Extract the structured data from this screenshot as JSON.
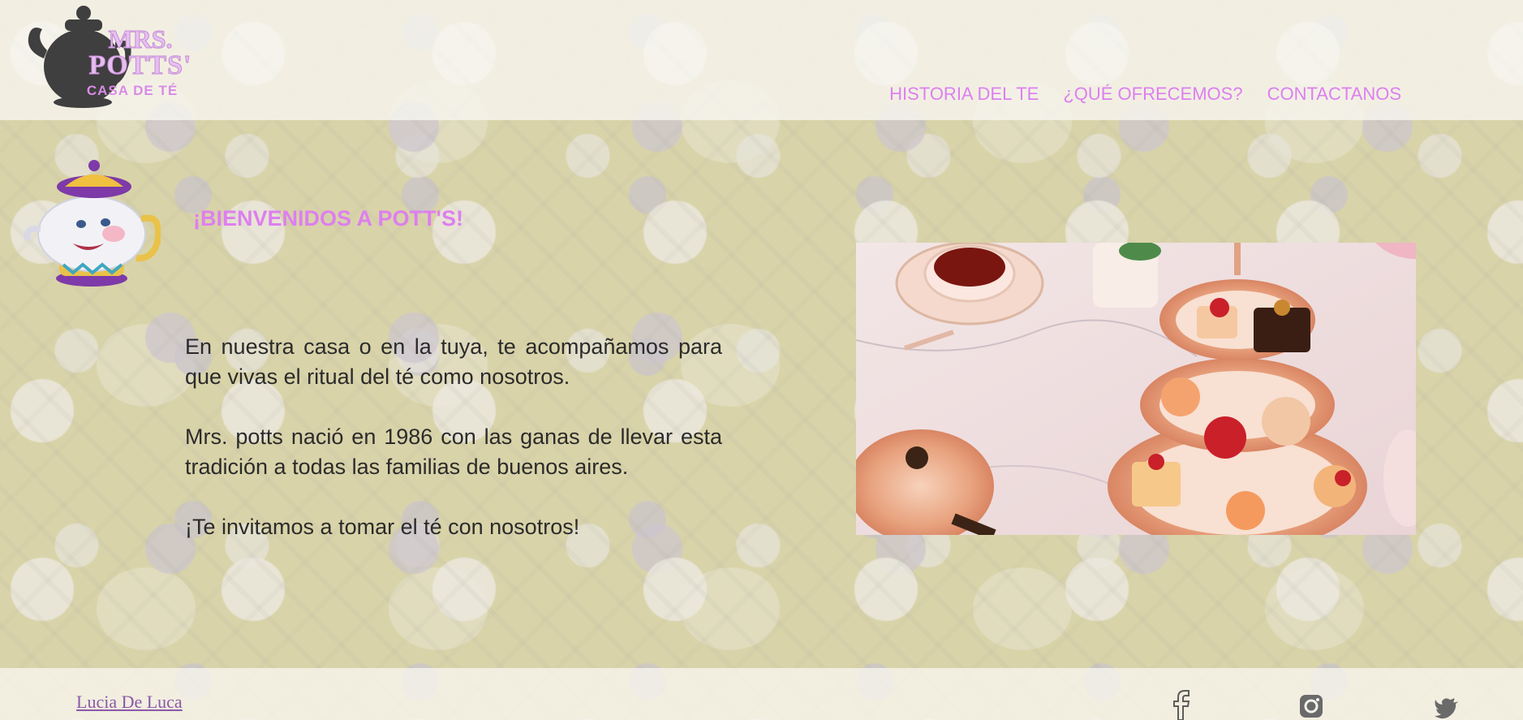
{
  "logo": {
    "line1": "MRS.",
    "line2": "POTTS'",
    "line3": "CASA DE TÉ",
    "icon": "teapot-icon"
  },
  "nav": {
    "items": [
      {
        "label": "HISTORIA DEL TE"
      },
      {
        "label": "¿QUÉ OFRECEMOS?"
      },
      {
        "label": "CONTACTANOS"
      }
    ]
  },
  "main": {
    "mascot_icon": "mrs-potts-teapot-icon",
    "heading": "¡BIENVENIDOS A POTT'S!",
    "paragraphs": [
      "En nuestra casa o en la tuya, te acompañamos para que vivas el ritual del té como nosotros.",
      "Mrs. potts nació en 1986 con las ganas de llevar esta tradición a todas las familias de buenos aires.",
      "¡Te invitamos a tomar el té con nosotros!"
    ],
    "photo_icon": "afternoon-tea-photo"
  },
  "footer": {
    "author": "Lucia De Luca",
    "social": [
      {
        "icon": "facebook-icon"
      },
      {
        "icon": "instagram-icon"
      },
      {
        "icon": "twitter-icon"
      }
    ]
  },
  "colors": {
    "accent": "#dd7fef",
    "text": "#2b2b2b",
    "background": "#d9d3a9"
  }
}
